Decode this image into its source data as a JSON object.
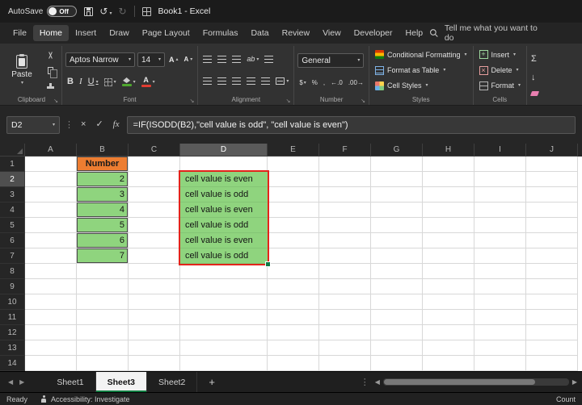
{
  "colors": {
    "number_header_fill": "#ED7D31",
    "value_fill": "#8FD47E",
    "range_highlight": "#E3241B",
    "excel_green": "#107C41"
  },
  "title_bar": {
    "autosave_label": "AutoSave",
    "autosave_state": "Off",
    "document_title": "Book1 - Excel"
  },
  "menu_bar": {
    "items": [
      "File",
      "Home",
      "Insert",
      "Draw",
      "Page Layout",
      "Formulas",
      "Data",
      "Review",
      "View",
      "Developer",
      "Help"
    ],
    "active_item": "Home",
    "search_label": "Tell me what you want to do"
  },
  "ribbon": {
    "group_labels": [
      "Clipboard",
      "Font",
      "Alignment",
      "Number",
      "Styles",
      "Cells"
    ],
    "clipboard": {
      "paste_label": "Paste"
    },
    "font": {
      "name": "Aptos Narrow",
      "size": "14"
    },
    "number": {
      "format": "General"
    },
    "styles": {
      "items": [
        "Conditional Formatting",
        "Format as Table",
        "Cell Styles"
      ]
    },
    "cells": {
      "items": [
        "Insert",
        "Delete",
        "Format"
      ]
    }
  },
  "formula_bar": {
    "name_box": "D2",
    "formula": "=IF(ISODD(B2),\"cell value is odd\", \"cell value is even\")"
  },
  "grid": {
    "columns": [
      "A",
      "B",
      "C",
      "D",
      "E",
      "F",
      "G",
      "H",
      "I",
      "J"
    ],
    "row_count": 14,
    "selection": {
      "column": "D",
      "row": 2
    },
    "number_column": {
      "column": "B",
      "header": "Number",
      "values": [
        "2",
        "3",
        "4",
        "5",
        "6",
        "7"
      ]
    },
    "result_column": {
      "column": "D",
      "values": [
        "cell value is even",
        "cell value is odd",
        "cell value is even",
        "cell value is odd",
        "cell value is even",
        "cell value is odd"
      ]
    }
  },
  "sheet_tabs": {
    "tabs": [
      "Sheet1",
      "Sheet3",
      "Sheet2"
    ],
    "active": "Sheet3",
    "add_label": "+"
  },
  "status_bar": {
    "mode": "Ready",
    "accessibility": "Accessibility: Investigate",
    "right_label": "Count"
  },
  "icons": {
    "dropdown": "▾",
    "caret_up": "▴",
    "undo": "↺",
    "redo": "↻",
    "cancel": "×",
    "confirm": "✓",
    "insert_function": "fx",
    "more_vertical": "⋮",
    "scroll_left": "◀",
    "scroll_right": "▶",
    "autosum": "Σ",
    "fill_down": "↓",
    "bold": "B",
    "italic": "I",
    "underline": "U",
    "letter_a": "A",
    "orientation": "ab",
    "accounting": "$",
    "percent": "%",
    "comma": ",",
    "increase_decimal": "←.0",
    "decrease_decimal": ".00→",
    "dialog_launcher": "↘"
  }
}
